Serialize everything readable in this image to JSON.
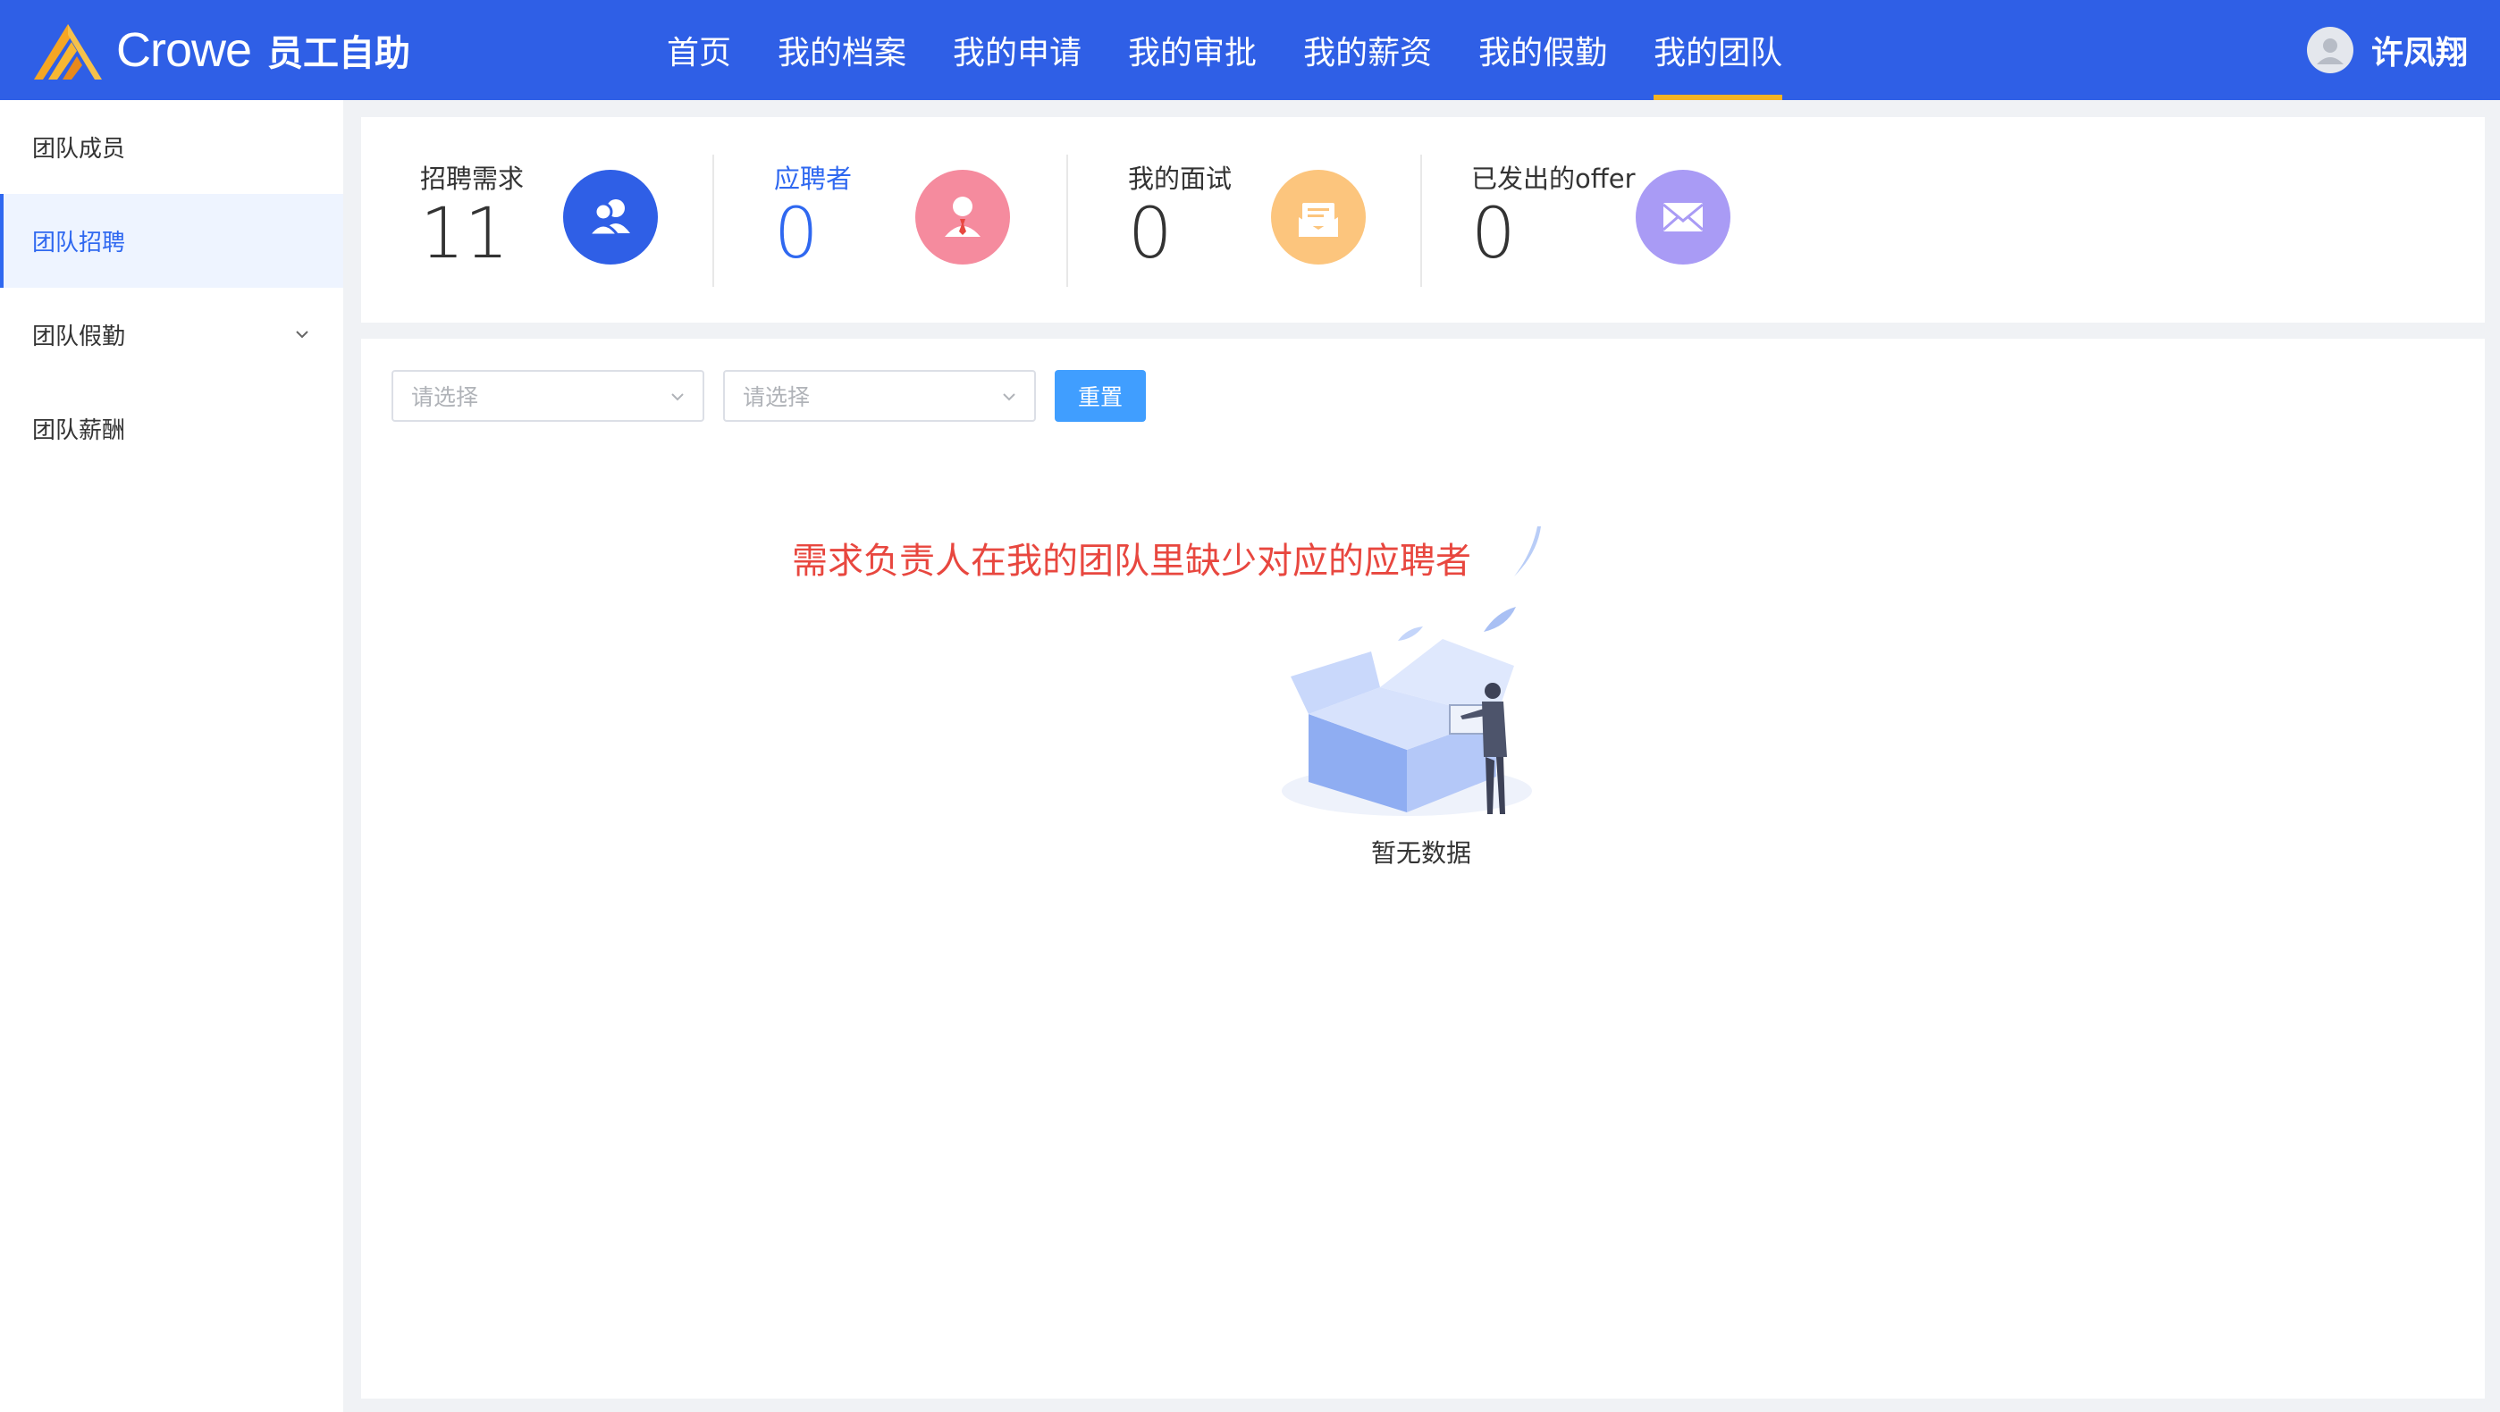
{
  "header": {
    "brand_name": "Crowe",
    "brand_sub": "员工自助",
    "nav": [
      {
        "label": "首页"
      },
      {
        "label": "我的档案"
      },
      {
        "label": "我的申请"
      },
      {
        "label": "我的审批"
      },
      {
        "label": "我的薪资"
      },
      {
        "label": "我的假勤"
      },
      {
        "label": "我的团队"
      }
    ],
    "active_nav": "我的团队",
    "user_name": "许凤翔"
  },
  "sidebar": {
    "items": [
      {
        "label": "团队成员"
      },
      {
        "label": "团队招聘"
      },
      {
        "label": "团队假勤"
      },
      {
        "label": "团队薪酬"
      }
    ],
    "active_item": "团队招聘"
  },
  "stats": [
    {
      "label": "招聘需求",
      "value": "11",
      "icon": "users-icon",
      "color": "#2f5fe6"
    },
    {
      "label": "应聘者",
      "value": "0",
      "icon": "applicant-icon",
      "color": "#f58b9e"
    },
    {
      "label": "我的面试",
      "value": "0",
      "icon": "envelope-open-icon",
      "color": "#fcc57d"
    },
    {
      "label": "已发出的offer",
      "value": "0",
      "icon": "mail-icon",
      "color": "#a99bf5"
    }
  ],
  "filters": {
    "select1_placeholder": "请选择",
    "select2_placeholder": "请选择",
    "reset_label": "重置"
  },
  "notice": "需求负责人在我的团队里缺少对应的应聘者",
  "empty_text": "暂无数据",
  "colors": {
    "header_bg": "#2f5fe6",
    "active_underline": "#f5b323",
    "primary_blue": "#2f68f0",
    "button_blue": "#409eff",
    "notice_red": "#e8473f"
  }
}
